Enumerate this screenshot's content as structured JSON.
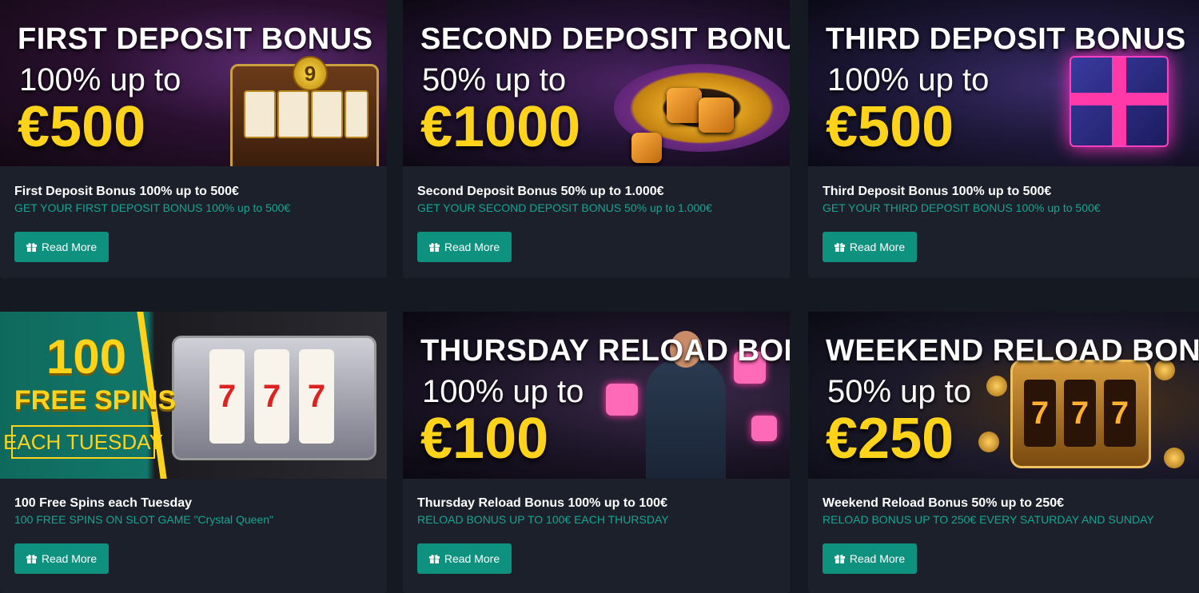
{
  "promotions": [
    {
      "banner": {
        "headline": "FIRST DEPOSIT BONUS",
        "sub": "100% up to",
        "amount": "€500"
      },
      "title": "First Deposit Bonus 100% up to 500€",
      "subtitle": "GET YOUR FIRST DEPOSIT BONUS 100% up to 500€",
      "button_label": "Read More"
    },
    {
      "banner": {
        "headline": "SECOND DEPOSIT BONUS",
        "sub": "50% up to",
        "amount": "€1000"
      },
      "title": "Second Deposit Bonus 50% up to 1.000€",
      "subtitle": "GET YOUR SECOND DEPOSIT BONUS 50% up to 1.000€",
      "button_label": "Read More"
    },
    {
      "banner": {
        "headline": "THIRD DEPOSIT BONUS",
        "sub": "100% up to",
        "amount": "€500"
      },
      "title": "Third Deposit Bonus 100% up to 500€",
      "subtitle": "GET YOUR THIRD DEPOSIT BONUS 100% up to 500€",
      "button_label": "Read More"
    },
    {
      "banner": {
        "big": "100",
        "line2": "FREE SPINS",
        "line3": "EACH TUESDAY"
      },
      "title": "100 Free Spins each Tuesday",
      "subtitle": "100 FREE SPINS ON SLOT GAME \"Crystal Queen\"",
      "button_label": "Read More"
    },
    {
      "banner": {
        "headline": "THURSDAY RELOAD BONUS",
        "sub": "100% up to",
        "amount": "€100"
      },
      "title": "Thursday Reload Bonus 100% up to 100€",
      "subtitle": "RELOAD BONUS UP TO 100€ EACH THURSDAY",
      "button_label": "Read More"
    },
    {
      "banner": {
        "headline": "WEEKEND RELOAD BONUS",
        "sub": "50% up to",
        "amount": "€250"
      },
      "title": "Weekend Reload Bonus 50% up to 250€",
      "subtitle": "RELOAD BONUS UP TO 250€ EVERY SATURDAY AND SUNDAY",
      "button_label": "Read More"
    }
  ],
  "banner_art": {
    "slot_symbol": "9",
    "gold_reels": [
      "7",
      "7",
      "7"
    ],
    "silver_reels": [
      "7",
      "7",
      "7"
    ]
  },
  "colors": {
    "page_bg": "#151922",
    "card_bg": "#1c202a",
    "accent_button": "#0f917f",
    "subtitle_text": "#16a594",
    "amount_yellow": "#ffd31a"
  },
  "icons": {
    "button_icon": "gift-icon"
  }
}
